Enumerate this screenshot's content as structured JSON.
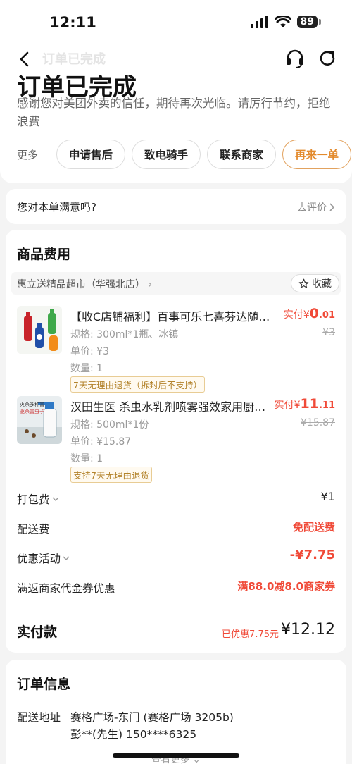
{
  "status": {
    "time": "12:11",
    "battery": "89"
  },
  "nav": {
    "title": "订单已完成"
  },
  "hero": {
    "big_title": "订单已完成",
    "description": "感谢您对美团外卖的信任，期待再次光临。请厉行节约，拒绝浪费",
    "more_label": "更多",
    "actions": [
      "申请售后",
      "致电骑手",
      "联系商家",
      "再来一单"
    ]
  },
  "satisfaction": {
    "question": "您对本单满意吗?",
    "go_rate": "去评价"
  },
  "goods": {
    "title": "商品费用",
    "store": "惠立送精品超市（华强北店）",
    "favorite": "收藏",
    "items": [
      {
        "title": "【收C店铺福利】百事可乐七喜芬达随机发货",
        "spec": "规格: 300ml*1瓶、冰镇",
        "unit_price": "单价: ¥3",
        "qty": "数量: 1",
        "tag": "7天无理由退货（拆封后不支持）",
        "paid_label": "实付",
        "paid_cur": "¥",
        "paid_int": "0",
        "paid_dec": ".01",
        "orig": "¥3"
      },
      {
        "title": "汉田生医 杀虫水乳剂喷雾强效家用厨房蟑螂",
        "spec": "规格: 500ml*1份",
        "unit_price": "单价: ¥15.87",
        "qty": "数量: 1",
        "tag": "支持7天无理由退货",
        "paid_label": "实付",
        "paid_cur": "¥",
        "paid_int": "11",
        "paid_dec": ".11",
        "orig": "¥15.87"
      }
    ],
    "thumb2_text": [
      "灭杀多种害",
      "驱杀害虫子"
    ],
    "fees": {
      "packing_label": "打包费",
      "packing_val": "¥1",
      "delivery_label": "配送费",
      "delivery_val": "免配送费",
      "promo_label": "优惠活动",
      "promo_val": "-¥7.75",
      "voucher_label": "满返商家代金券优惠",
      "voucher_val": "满88.0减8.0商家券"
    },
    "total": {
      "label": "实付款",
      "saved": "已优惠7.75元",
      "value": "¥12.12"
    }
  },
  "order_info": {
    "title": "订单信息",
    "address_label": "配送地址",
    "address_line1": "赛格广场-东门 (赛格广场 3205b)",
    "address_line2": "彭**(先生) 150****6325",
    "see_more": "查看更多"
  },
  "colors": {
    "accent_red": "#f04a38",
    "accent_orange": "#e38a2c",
    "background": "#f4f4f4"
  }
}
